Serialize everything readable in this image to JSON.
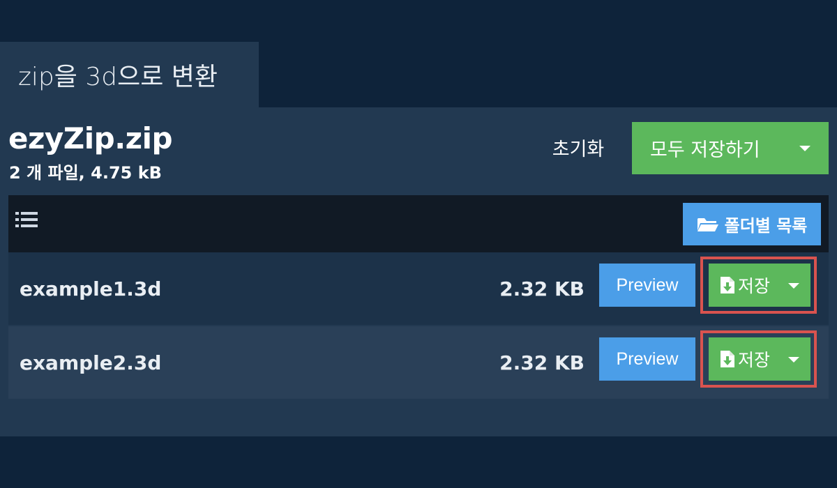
{
  "tab": {
    "title": "zip을 3d으로 변환"
  },
  "archive": {
    "name": "ezyZip.zip",
    "summary": "2 개 파일, 4.75 kB"
  },
  "actions": {
    "reset_label": "초기화",
    "save_all_label": "모두 저장하기",
    "save_all_icon": "caret-down-icon"
  },
  "toolbar": {
    "list_icon": "list-icon",
    "folder_view_label": "폴더별 목록",
    "folder_view_icon": "folder-open-icon"
  },
  "files": [
    {
      "name": "example1.3d",
      "size": "2.32 KB",
      "preview_label": "Preview",
      "save_label": "저장",
      "save_icon": "file-download-icon"
    },
    {
      "name": "example2.3d",
      "size": "2.32 KB",
      "preview_label": "Preview",
      "save_label": "저장",
      "save_icon": "file-download-icon"
    }
  ],
  "colors": {
    "page_bg": "#0e233a",
    "panel_bg": "#223951",
    "toolbar_bg": "#111a25",
    "row_bg_odd": "#1c3249",
    "row_bg_even": "#2a4058",
    "save_green": "#5cb85c",
    "preview_blue": "#4b9ee8",
    "highlight_red": "#d9534f"
  }
}
